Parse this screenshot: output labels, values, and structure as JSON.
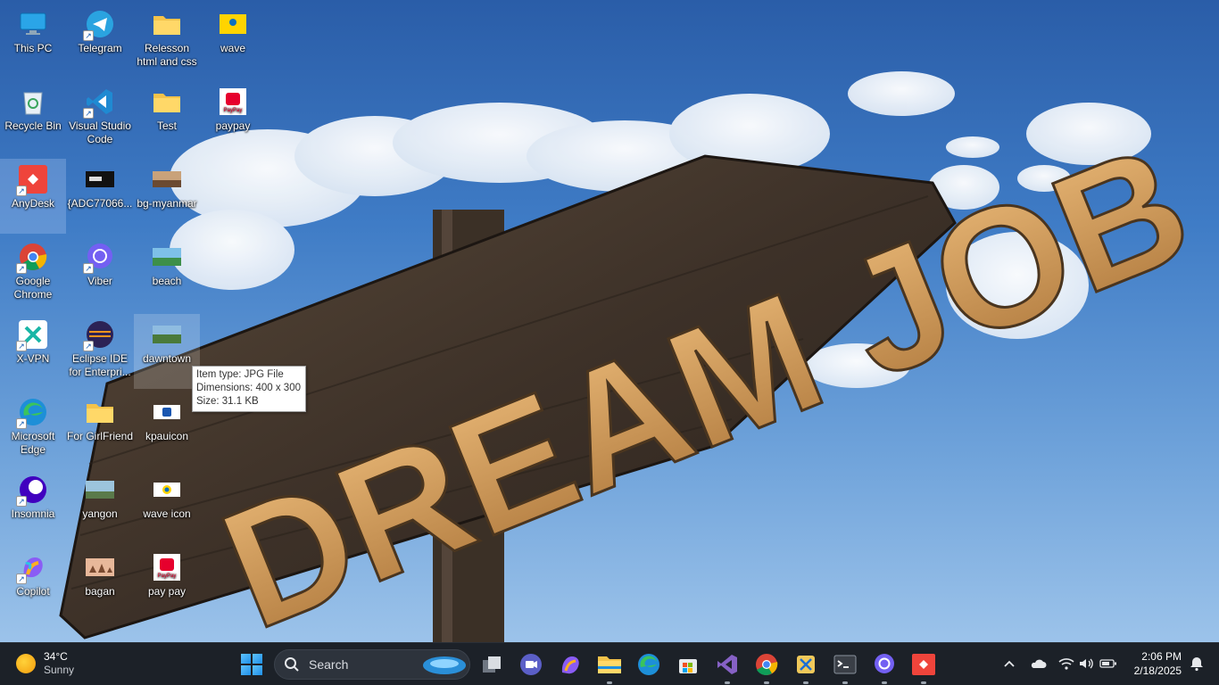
{
  "desktop": {
    "icons": [
      {
        "label": "This PC",
        "icon": "monitor-icon"
      },
      {
        "label": "Telegram",
        "icon": "telegram-icon"
      },
      {
        "label": "Relesson html and css",
        "icon": "folder-icon"
      },
      {
        "label": "wave",
        "icon": "wave-icon"
      },
      {
        "label": "Recycle Bin",
        "icon": "recycle-bin-icon"
      },
      {
        "label": "Visual Studio Code",
        "icon": "vscode-icon"
      },
      {
        "label": "Test",
        "icon": "folder-icon"
      },
      {
        "label": "paypay",
        "icon": "paypay-icon"
      },
      {
        "label": "AnyDesk",
        "icon": "anydesk-icon"
      },
      {
        "label": "{ADC77066...",
        "icon": "image-file-icon"
      },
      {
        "label": "bg-myanmar",
        "icon": "image-file-icon"
      },
      {
        "label": "Google Chrome",
        "icon": "chrome-icon"
      },
      {
        "label": "Viber",
        "icon": "viber-icon"
      },
      {
        "label": "beach",
        "icon": "image-file-icon"
      },
      {
        "label": "X-VPN",
        "icon": "xvpn-icon"
      },
      {
        "label": "Eclipse IDE for Enterpri...",
        "icon": "eclipse-icon"
      },
      {
        "label": "dawntown",
        "icon": "image-file-icon"
      },
      {
        "label": "Microsoft Edge",
        "icon": "edge-icon"
      },
      {
        "label": "For GirlFriend",
        "icon": "folder-icon"
      },
      {
        "label": "kpauicon",
        "icon": "image-file-icon"
      },
      {
        "label": "Insomnia",
        "icon": "insomnia-icon"
      },
      {
        "label": "yangon",
        "icon": "image-file-icon"
      },
      {
        "label": "wave icon",
        "icon": "image-file-icon"
      },
      {
        "label": "Copilot",
        "icon": "copilot-icon"
      },
      {
        "label": "bagan",
        "icon": "image-file-icon"
      },
      {
        "label": "pay pay",
        "icon": "paypay-icon"
      }
    ]
  },
  "wallpaper": {
    "sign_text": "DREAM JOB"
  },
  "tooltip": {
    "type": "Item type: JPG File",
    "dimensions": "Dimensions: 400 x 300",
    "size": "Size: 31.1 KB"
  },
  "taskbar": {
    "weather": {
      "temp": "34°C",
      "condition": "Sunny"
    },
    "search_placeholder": "Search",
    "apps": [
      "task-view",
      "teams-meet",
      "copilot",
      "file-explorer",
      "edge",
      "store",
      "visual-studio",
      "chrome",
      "snipping-tool",
      "terminal",
      "viber",
      "anydesk"
    ],
    "clock": {
      "time": "2:06 PM",
      "date": "2/18/2025"
    }
  },
  "colors": {
    "taskbar": "#1c2128",
    "sky": "#3f7cc6",
    "accent": "#1f8fe6"
  }
}
